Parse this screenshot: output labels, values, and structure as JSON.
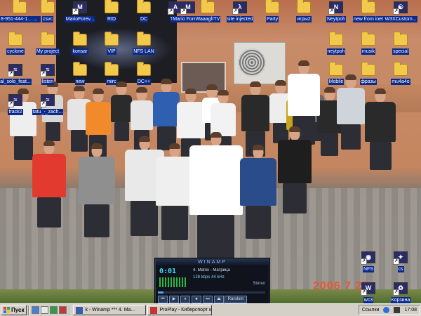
{
  "desktop": {
    "icons": [
      {
        "label": "8-951-444-1... amazing ale...",
        "icon": "folder-icon",
        "kind": "folder"
      },
      {
        "label": "csvc",
        "icon": "folder-icon",
        "kind": "folder"
      },
      {
        "label": "MarioForev...",
        "icon": "app-shortcut-icon",
        "kind": "app",
        "glyph": "M"
      },
      {
        "label": "RID",
        "icon": "folder-icon",
        "kind": "folder"
      },
      {
        "label": "DC",
        "icon": "folder-icon",
        "kind": "folder"
      },
      {
        "label": "TEG",
        "icon": "teg-shortcut-icon",
        "kind": "app",
        "glyph": "A"
      },
      {
        "label": "Mario Forever",
        "icon": "mario-shortcut-icon",
        "kind": "app",
        "glyph": "M"
      },
      {
        "label": "WaaaghTV",
        "icon": "folder-icon",
        "kind": "folder"
      },
      {
        "label": "site injected",
        "icon": "half-life-shortcut-icon",
        "kind": "app",
        "glyph": "λ"
      },
      {
        "label": "Party",
        "icon": "folder-icon",
        "kind": "folder"
      },
      {
        "label": "игры2",
        "icon": "folder-icon",
        "kind": "folder"
      },
      {
        "label": "Neytpoh",
        "icon": "document-shortcut-icon",
        "kind": "app",
        "glyph": "N"
      },
      {
        "label": "new from inet",
        "icon": "folder-icon",
        "kind": "folder"
      },
      {
        "label": "W3XCustom...",
        "icon": "yin-yang-shortcut-icon",
        "kind": "app",
        "glyph": "☯"
      },
      {
        "label": "cyclone",
        "icon": "folder-icon",
        "kind": "folder"
      },
      {
        "label": "My project",
        "icon": "folder-icon",
        "kind": "folder"
      },
      {
        "label": "konsar",
        "icon": "folder-icon",
        "kind": "folder"
      },
      {
        "label": "VIP",
        "icon": "folder-icon",
        "kind": "folder"
      },
      {
        "label": "NFS LAN",
        "icon": "folder-icon",
        "kind": "folder"
      },
      {
        "label": "neytpoh",
        "icon": "folder-icon",
        "kind": "folder"
      },
      {
        "label": "musik",
        "icon": "folder-icon",
        "kind": "folder"
      },
      {
        "label": "special",
        "icon": "folder-icon",
        "kind": "folder"
      },
      {
        "label": "al_solo_feat...",
        "icon": "winamp-shortcut-icon",
        "kind": "app",
        "glyph": "≈"
      },
      {
        "label": "listen",
        "icon": "winamp-shortcut-icon",
        "kind": "app",
        "glyph": "≈"
      },
      {
        "label": "new",
        "icon": "folder-icon",
        "kind": "folder"
      },
      {
        "label": "mirc",
        "icon": "folder-icon",
        "kind": "folder"
      },
      {
        "label": "DC++",
        "icon": "folder-icon",
        "kind": "folder"
      },
      {
        "label": "Mobile",
        "icon": "folder-icon",
        "kind": "folder"
      },
      {
        "label": "фразы",
        "icon": "folder-icon",
        "kind": "folder"
      },
      {
        "label": "mu4a4o",
        "icon": "folder-icon",
        "kind": "folder"
      },
      {
        "label": "track2",
        "icon": "winamp-shortcut-icon",
        "kind": "app",
        "glyph": "≈"
      },
      {
        "label": "tatu_-_zach...",
        "icon": "winamp-shortcut-icon",
        "kind": "app",
        "glyph": "≈"
      },
      {
        "label": "NFS",
        "icon": "nfs-shortcut-icon",
        "kind": "app",
        "glyph": "◉"
      },
      {
        "label": "cs",
        "icon": "counter-strike-shortcut-icon",
        "kind": "app",
        "glyph": "✦"
      },
      {
        "label": "wc3",
        "icon": "warcraft-shortcut-icon",
        "kind": "app",
        "glyph": "W"
      },
      {
        "label": "Корзина",
        "icon": "recycle-bin-icon",
        "kind": "app",
        "glyph": "♻"
      }
    ],
    "photo_date": "2006  7  25"
  },
  "winamp": {
    "title": "WINAMP",
    "time": "0:01",
    "track_text": "4. Matrix - Матрица",
    "kbps": "128",
    "khz": "44",
    "mode": "Stereo",
    "random_label": "Random",
    "seek_position": 0.05,
    "buttons": [
      "⏮",
      "▶",
      "⏸",
      "⏹",
      "⏭",
      "⏏"
    ],
    "colors": {
      "display": "#36e0ff",
      "frame": "#10131c"
    }
  },
  "taskbar": {
    "start_label": "Пуск",
    "tasks": [
      {
        "label": "k - Winamp *** 4. Ma...",
        "icon": "winamp-task-icon"
      },
      {
        "label": "ProPlay - Киберспорт к...",
        "icon": "opera-task-icon"
      }
    ],
    "tray": {
      "links_label": "Ссылки",
      "clock": "17:08"
    }
  }
}
